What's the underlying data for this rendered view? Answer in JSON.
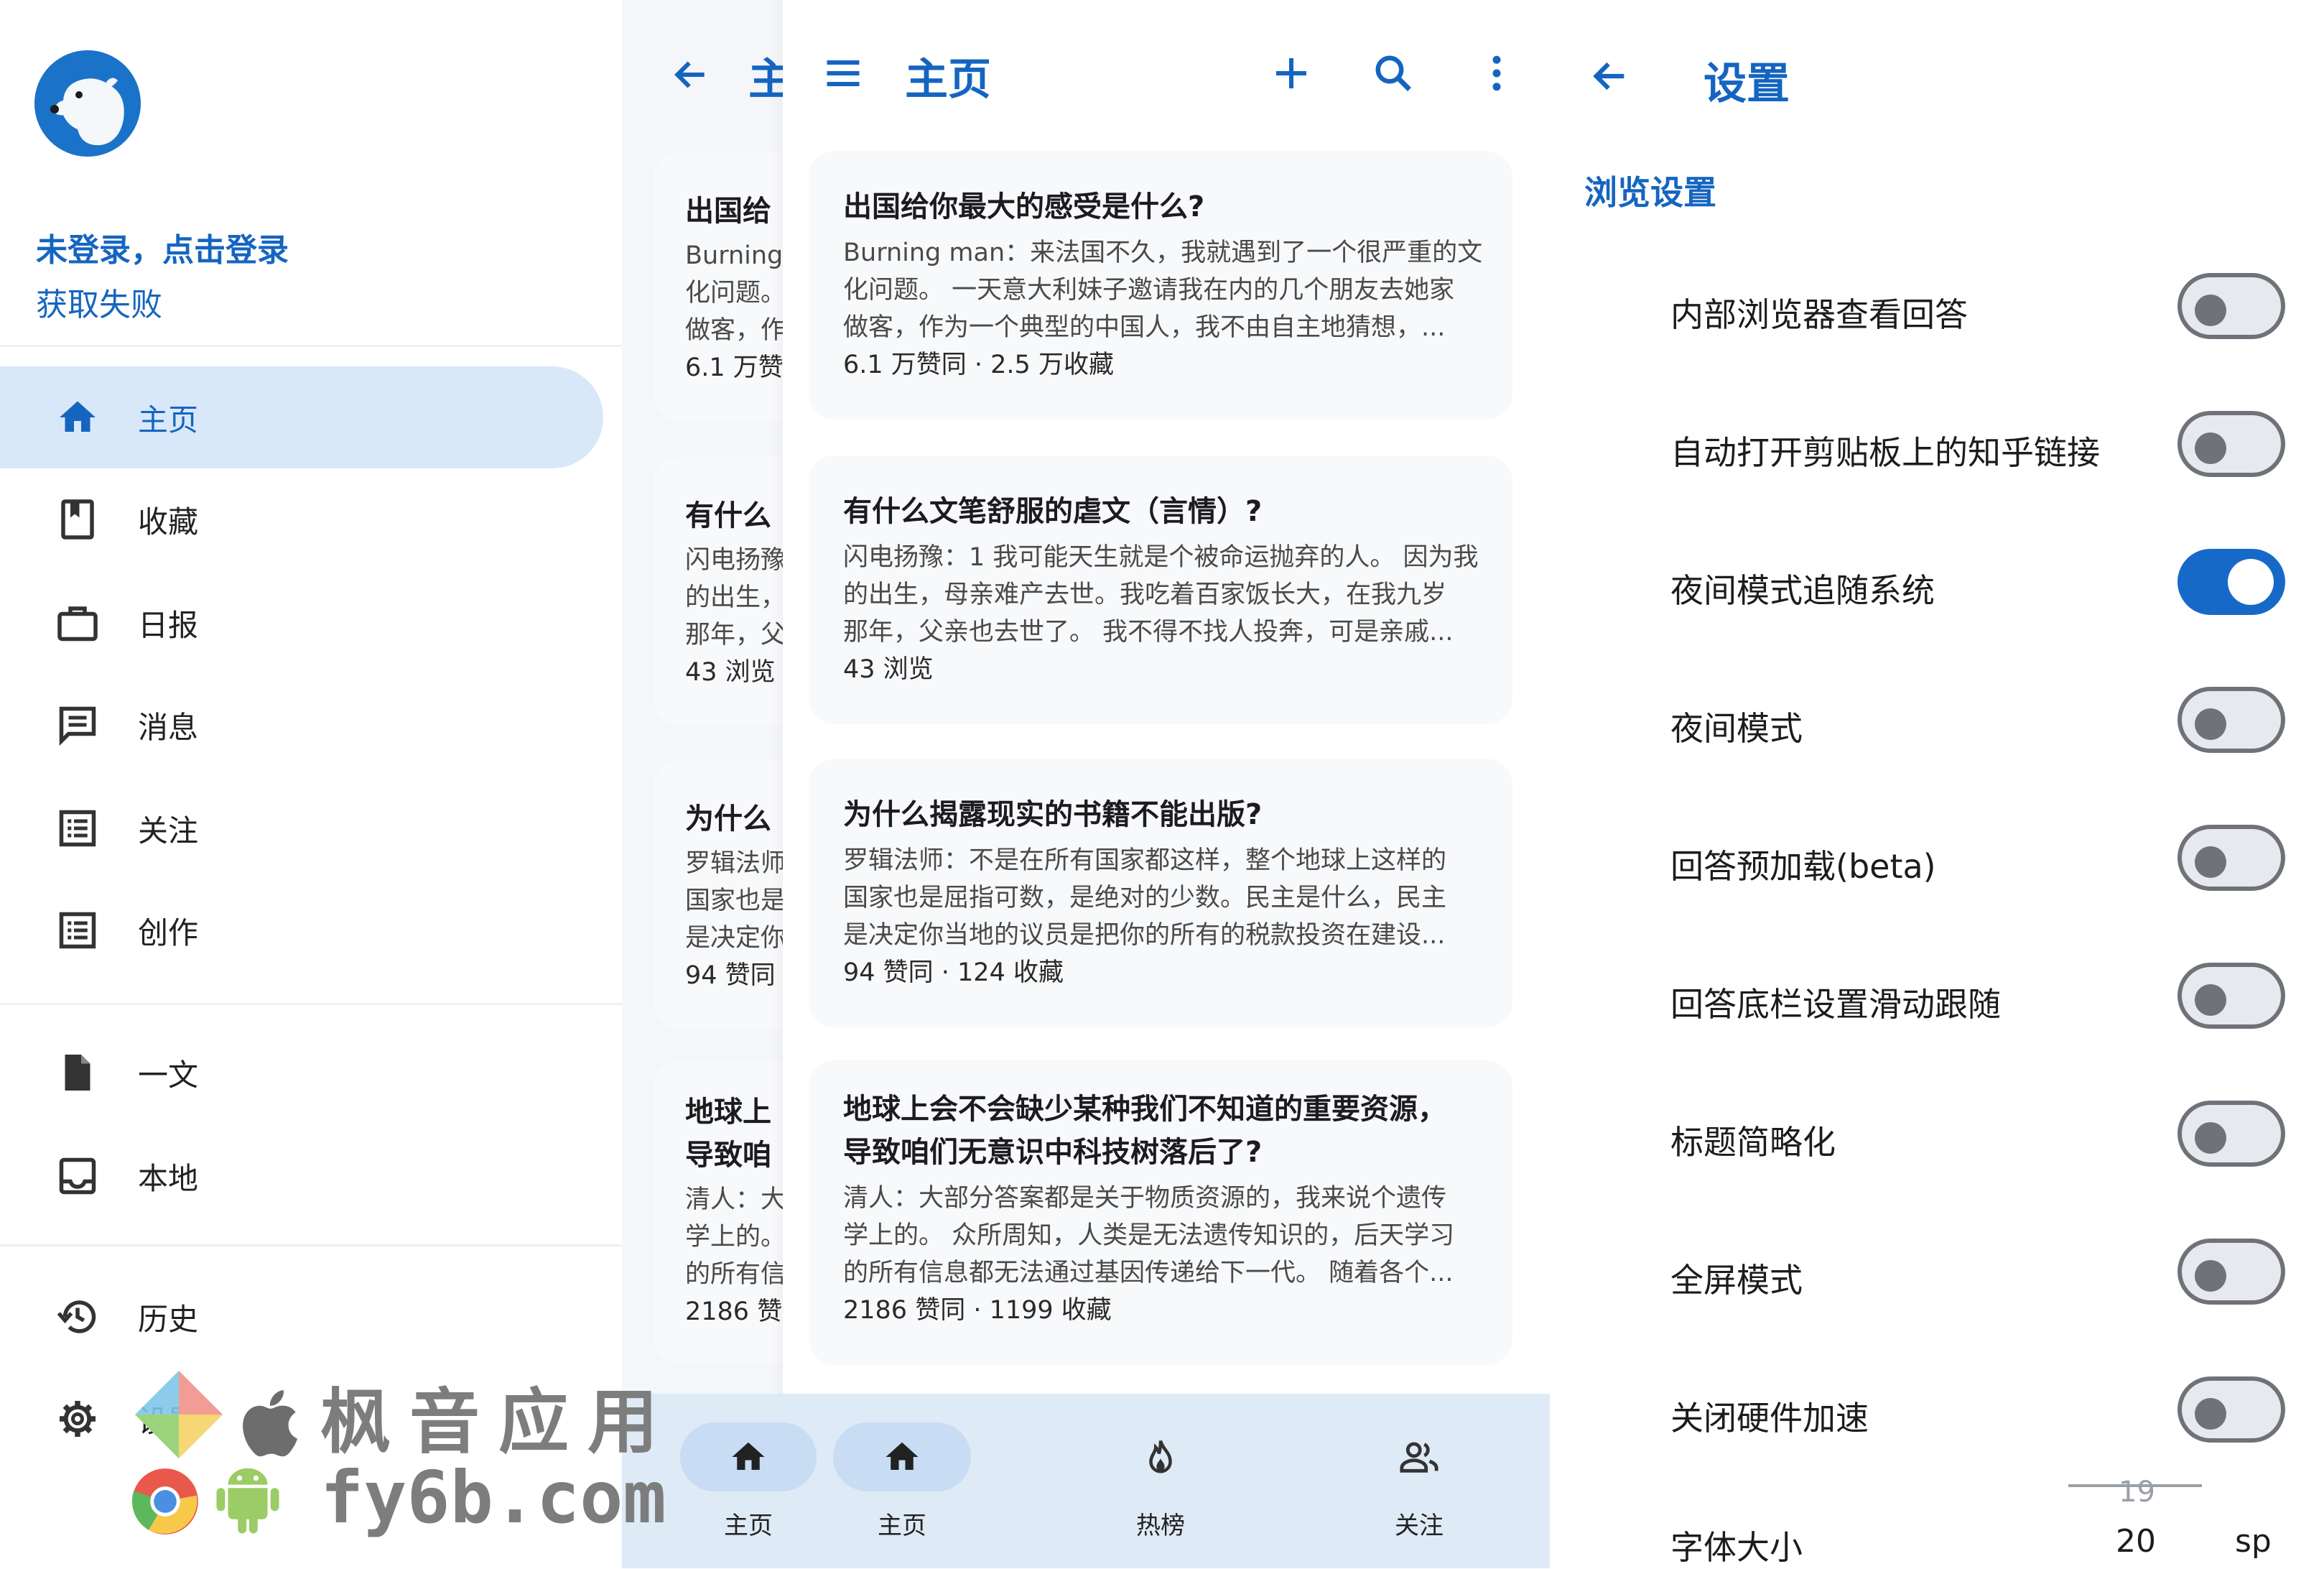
{
  "drawer": {
    "login_title": "未登录，点击登录",
    "login_status": "获取失败",
    "items": [
      {
        "label": "主页",
        "icon": "home-icon",
        "active": true
      },
      {
        "label": "收藏",
        "icon": "bookmark-icon"
      },
      {
        "label": "日报",
        "icon": "briefcase-icon"
      },
      {
        "label": "消息",
        "icon": "message-icon"
      },
      {
        "label": "关注",
        "icon": "list-icon"
      },
      {
        "label": "创作",
        "icon": "list-icon"
      },
      {
        "label": "一文",
        "icon": "file-icon"
      },
      {
        "label": "本地",
        "icon": "inbox-icon"
      },
      {
        "label": "历史",
        "icon": "history-icon"
      },
      {
        "label": "设置",
        "icon": "gear-icon"
      }
    ]
  },
  "main": {
    "title": "主页",
    "title_partial": "主",
    "cards": [
      {
        "title": "出国给你最大的感受是什么?",
        "title_partial": "出国给",
        "excerpt_lines": [
          "Burning man：来法国不久，我就遇到了一个很严重的文",
          "化问题。 一天意大利妹子邀请我在内的几个朋友去她家",
          "做客，作为一个典型的中国人，我不由自主地猜想，..."
        ],
        "excerpt_partial": [
          "Burning",
          "化问题。",
          "做客，作"
        ],
        "meta": "6.1 万赞同 · 2.5 万收藏",
        "meta_partial": "6.1 万赞"
      },
      {
        "title": "有什么文笔舒服的虐文（言情）?",
        "title_partial": "有什么",
        "excerpt_lines": [
          "闪电扬豫：1 我可能天生就是个被命运抛弃的人。 因为我",
          "的出生，母亲难产去世。我吃着百家饭长大，在我九岁",
          "那年，父亲也去世了。 我不得不找人投奔，可是亲戚..."
        ],
        "excerpt_partial": [
          "闪电扬豫",
          "的出生，",
          "那年，父"
        ],
        "meta": "43 浏览",
        "meta_partial": "43 浏览"
      },
      {
        "title": "为什么揭露现实的书籍不能出版?",
        "title_partial": "为什么",
        "excerpt_lines": [
          "罗辑法师：不是在所有国家都这样，整个地球上这样的",
          "国家也是屈指可数，是绝对的少数。民主是什么，民主",
          "是决定你当地的议员是把你的所有的税款投资在建设..."
        ],
        "excerpt_partial": [
          "罗辑法师",
          "国家也是",
          "是决定你"
        ],
        "meta": "94 赞同 · 124 收藏",
        "meta_partial": "94 赞同"
      },
      {
        "title_lines": [
          "地球上会不会缺少某种我们不知道的重要资源，",
          "导致咱们无意识中科技树落后了?"
        ],
        "title_partial": [
          "地球上",
          "导致咱"
        ],
        "excerpt_lines": [
          "清人：大部分答案都是关于物质资源的，我来说个遗传",
          "学上的。 众所周知，人类是无法遗传知识的，后天学习",
          "的所有信息都无法通过基因传递给下一代。 随着各个..."
        ],
        "excerpt_partial": [
          "清人：大",
          "学上的。",
          "的所有信"
        ],
        "meta": "2186 赞同 · 1199 收藏",
        "meta_partial": "2186 赞"
      }
    ],
    "bottom_nav": [
      {
        "label": "主页",
        "icon": "home-icon",
        "active": true
      },
      {
        "label": "热榜",
        "icon": "fire-icon"
      },
      {
        "label": "关注",
        "icon": "people-icon"
      }
    ],
    "bottom_partial_label": "主页"
  },
  "settings": {
    "title": "设置",
    "section": "浏览设置",
    "items": [
      {
        "label": "内部浏览器查看回答",
        "on": false
      },
      {
        "label": "自动打开剪贴板上的知乎链接",
        "on": false
      },
      {
        "label": "夜间模式追随系统",
        "on": true
      },
      {
        "label": "夜间模式",
        "on": false
      },
      {
        "label": "回答预加载(beta)",
        "on": false
      },
      {
        "label": "回答底栏设置滑动跟随",
        "on": false
      },
      {
        "label": "标题简略化",
        "on": false
      },
      {
        "label": "全屏模式",
        "on": false
      },
      {
        "label": "关闭硬件加速",
        "on": false
      }
    ],
    "font_size_label": "字体大小",
    "font_size_prev": "19",
    "font_size_value": "20",
    "font_size_unit": "sp"
  },
  "watermark": {
    "line1": "枫音应用",
    "line2": "fy6b.com"
  },
  "colors": {
    "accent": "#1565c0",
    "switch_on": "#1669c8",
    "drawer_active_bg": "#d9e8f8",
    "bottom_bar_bg": "#dfeaf7"
  }
}
